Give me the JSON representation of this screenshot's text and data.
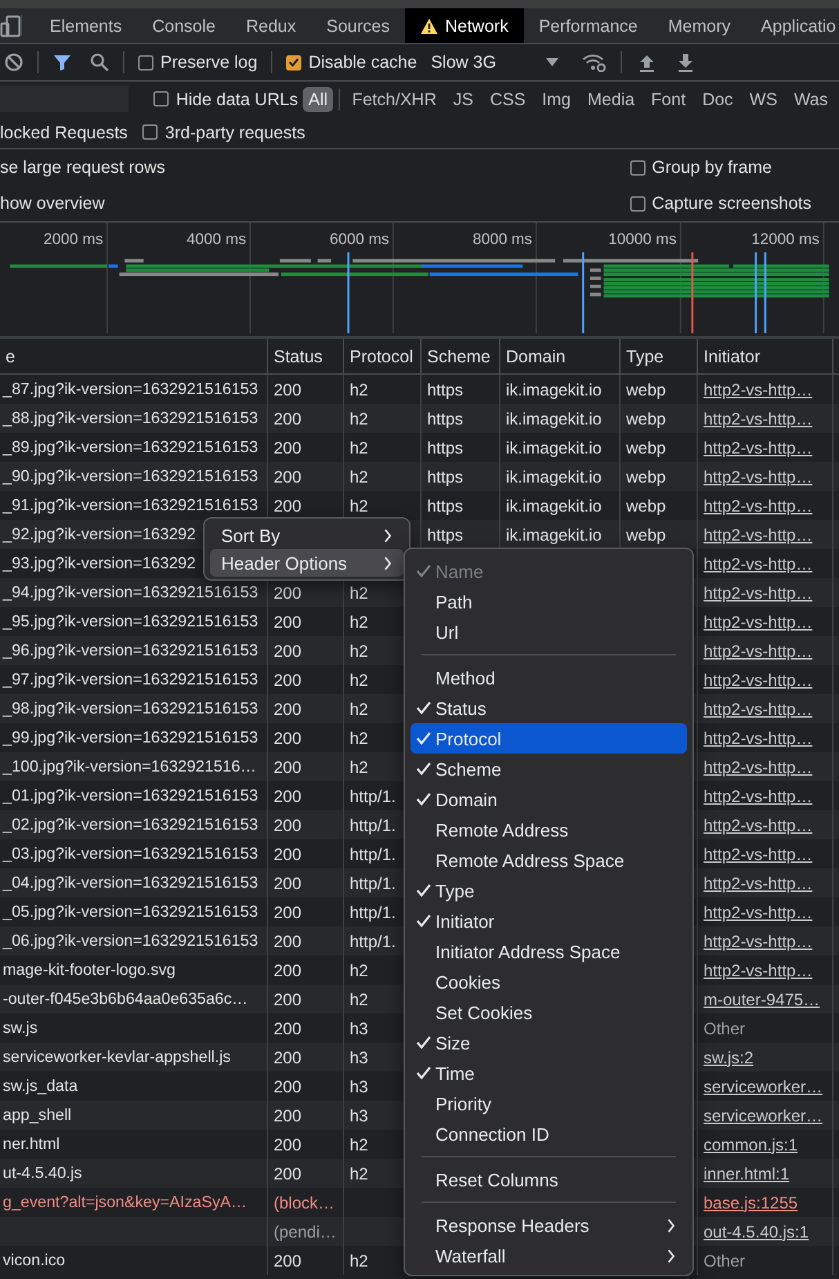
{
  "tabs": [
    {
      "label": "Elements",
      "selected": false,
      "warning": false
    },
    {
      "label": "Console",
      "selected": false,
      "warning": false
    },
    {
      "label": "Redux",
      "selected": false,
      "warning": false
    },
    {
      "label": "Sources",
      "selected": false,
      "warning": false
    },
    {
      "label": "Network",
      "selected": true,
      "warning": true
    },
    {
      "label": "Performance",
      "selected": false,
      "warning": false
    },
    {
      "label": "Memory",
      "selected": false,
      "warning": false
    },
    {
      "label": "Applicatio",
      "selected": false,
      "warning": false
    }
  ],
  "toolbar": {
    "preserve_log": {
      "label": "Preserve log",
      "checked": false
    },
    "disable_cache": {
      "label": "Disable cache",
      "checked": true
    },
    "throttling": "Slow 3G"
  },
  "filter_bar": {
    "hide_data_urls": {
      "label": "Hide data URLs",
      "checked": false
    },
    "types": [
      {
        "label": "All",
        "selected": true
      },
      {
        "label": "Fetch/XHR",
        "selected": false
      },
      {
        "label": "JS",
        "selected": false
      },
      {
        "label": "CSS",
        "selected": false
      },
      {
        "label": "Img",
        "selected": false
      },
      {
        "label": "Media",
        "selected": false
      },
      {
        "label": "Font",
        "selected": false
      },
      {
        "label": "Doc",
        "selected": false
      },
      {
        "label": "WS",
        "selected": false
      },
      {
        "label": "Was",
        "selected": false
      }
    ]
  },
  "filter_row_2": {
    "blocked_label": "locked Requests",
    "third_party": {
      "label": "3rd-party requests",
      "checked": false
    }
  },
  "settings": {
    "left": [
      "se large request rows",
      "how overview"
    ],
    "right": [
      {
        "label": "Group by frame",
        "checked": false
      },
      {
        "label": "Capture screenshots",
        "checked": false
      }
    ]
  },
  "overview": {
    "ticks": [
      "2000 ms",
      "4000 ms",
      "6000 ms",
      "8000 ms",
      "10000 ms",
      "12000 ms"
    ]
  },
  "table": {
    "columns": [
      "e",
      "Status",
      "Protocol",
      "Scheme",
      "Domain",
      "Type",
      "Initiator"
    ],
    "rows": [
      {
        "kind": "normal",
        "name": "_87.jpg?ik-version=1632921516153",
        "status": "200",
        "protocol": "h2",
        "scheme": "https",
        "domain": "ik.imagekit.io",
        "type": "webp",
        "initiator": {
          "text": "http2-vs-http…",
          "link": true
        }
      },
      {
        "kind": "normal",
        "name": "_88.jpg?ik-version=1632921516153",
        "status": "200",
        "protocol": "h2",
        "scheme": "https",
        "domain": "ik.imagekit.io",
        "type": "webp",
        "initiator": {
          "text": "http2-vs-http…",
          "link": true
        }
      },
      {
        "kind": "normal",
        "name": "_89.jpg?ik-version=1632921516153",
        "status": "200",
        "protocol": "h2",
        "scheme": "https",
        "domain": "ik.imagekit.io",
        "type": "webp",
        "initiator": {
          "text": "http2-vs-http…",
          "link": true
        }
      },
      {
        "kind": "normal",
        "name": "_90.jpg?ik-version=1632921516153",
        "status": "200",
        "protocol": "h2",
        "scheme": "https",
        "domain": "ik.imagekit.io",
        "type": "webp",
        "initiator": {
          "text": "http2-vs-http…",
          "link": true
        }
      },
      {
        "kind": "normal",
        "name": "_91.jpg?ik-version=1632921516153",
        "status": "200",
        "protocol": "h2",
        "scheme": "https",
        "domain": "ik.imagekit.io",
        "type": "webp",
        "initiator": {
          "text": "http2-vs-http…",
          "link": true
        }
      },
      {
        "kind": "normal",
        "name": "_92.jpg?ik-version=163292",
        "scheme": "https",
        "domain": "ik.imagekit.io",
        "type": "webp",
        "initiator": {
          "text": "http2-vs-http…",
          "link": true
        }
      },
      {
        "kind": "normal",
        "name": "_93.jpg?ik-version=163292",
        "initiator": {
          "text": "http2-vs-http…",
          "link": true
        }
      },
      {
        "kind": "normal",
        "name": "_94.jpg?ik-version=1632921516153",
        "status": "200",
        "protocol": "h2",
        "initiator": {
          "text": "http2-vs-http…",
          "link": true
        }
      },
      {
        "kind": "normal",
        "name": "_95.jpg?ik-version=1632921516153",
        "status": "200",
        "protocol": "h2",
        "initiator": {
          "text": "http2-vs-http…",
          "link": true
        }
      },
      {
        "kind": "normal",
        "name": "_96.jpg?ik-version=1632921516153",
        "status": "200",
        "protocol": "h2",
        "initiator": {
          "text": "http2-vs-http…",
          "link": true
        }
      },
      {
        "kind": "normal",
        "name": "_97.jpg?ik-version=1632921516153",
        "status": "200",
        "protocol": "h2",
        "initiator": {
          "text": "http2-vs-http…",
          "link": true
        }
      },
      {
        "kind": "normal",
        "name": "_98.jpg?ik-version=1632921516153",
        "status": "200",
        "protocol": "h2",
        "initiator": {
          "text": "http2-vs-http…",
          "link": true
        }
      },
      {
        "kind": "normal",
        "name": "_99.jpg?ik-version=1632921516153",
        "status": "200",
        "protocol": "h2",
        "initiator": {
          "text": "http2-vs-http…",
          "link": true
        }
      },
      {
        "kind": "normal",
        "name": "_100.jpg?ik-version=1632921516…",
        "status": "200",
        "protocol": "h2",
        "initiator": {
          "text": "http2-vs-http…",
          "link": true
        }
      },
      {
        "kind": "normal",
        "name": "_01.jpg?ik-version=1632921516153",
        "status": "200",
        "protocol": "http/1.",
        "initiator": {
          "text": "http2-vs-http…",
          "link": true
        }
      },
      {
        "kind": "normal",
        "name": "_02.jpg?ik-version=1632921516153",
        "status": "200",
        "protocol": "http/1.",
        "initiator": {
          "text": "http2-vs-http…",
          "link": true
        }
      },
      {
        "kind": "normal",
        "name": "_03.jpg?ik-version=1632921516153",
        "status": "200",
        "protocol": "http/1.",
        "initiator": {
          "text": "http2-vs-http…",
          "link": true
        }
      },
      {
        "kind": "normal",
        "name": "_04.jpg?ik-version=1632921516153",
        "status": "200",
        "protocol": "http/1.",
        "initiator": {
          "text": "http2-vs-http…",
          "link": true
        }
      },
      {
        "kind": "normal",
        "name": "_05.jpg?ik-version=1632921516153",
        "status": "200",
        "protocol": "http/1.",
        "initiator": {
          "text": "http2-vs-http…",
          "link": true
        }
      },
      {
        "kind": "normal",
        "name": "_06.jpg?ik-version=1632921516153",
        "status": "200",
        "protocol": "http/1.",
        "initiator": {
          "text": "http2-vs-http…",
          "link": true
        }
      },
      {
        "kind": "normal",
        "name": "mage-kit-footer-logo.svg",
        "status": "200",
        "protocol": "h2",
        "initiator": {
          "text": "http2-vs-http…",
          "link": true
        }
      },
      {
        "kind": "normal",
        "name": "-outer-f045e3b6b64aa0e635a6c…",
        "status": "200",
        "protocol": "h2",
        "initiator": {
          "text": "m-outer-9475…",
          "link": true
        }
      },
      {
        "kind": "normal",
        "name": "sw.js",
        "status": "200",
        "protocol": "h3",
        "initiator": {
          "text": "Other",
          "link": false
        }
      },
      {
        "kind": "normal",
        "name": "serviceworker-kevlar-appshell.js",
        "status": "200",
        "protocol": "h3",
        "initiator": {
          "text": "sw.js:2",
          "link": true
        }
      },
      {
        "kind": "normal",
        "name": "sw.js_data",
        "status": "200",
        "protocol": "h3",
        "initiator": {
          "text": "serviceworker…",
          "link": true
        }
      },
      {
        "kind": "normal",
        "name": "app_shell",
        "status": "200",
        "protocol": "h3",
        "initiator": {
          "text": "serviceworker…",
          "link": true
        }
      },
      {
        "kind": "normal",
        "name": "ner.html",
        "status": "200",
        "protocol": "h2",
        "initiator": {
          "text": "common.js:1",
          "link": true
        }
      },
      {
        "kind": "normal",
        "name": "ut-4.5.40.js",
        "status": "200",
        "protocol": "h2",
        "initiator": {
          "text": "inner.html:1",
          "link": true
        }
      },
      {
        "kind": "blocked",
        "name": "g_event?alt=json&key=AIzaSyA…",
        "status": "(block…",
        "initiator": {
          "text": "base.js:1255",
          "link": true
        }
      },
      {
        "kind": "pending",
        "status": "(pendi…",
        "initiator": {
          "text": "out-4.5.40.js:1",
          "link": true
        }
      },
      {
        "kind": "normal",
        "name": "vicon.ico",
        "status": "200",
        "protocol": "h2",
        "initiator": {
          "text": "Other",
          "link": false
        }
      }
    ]
  },
  "context_menu": {
    "items": [
      {
        "label": "Sort By",
        "selected": false
      },
      {
        "label": "Header Options",
        "selected": true
      }
    ]
  },
  "header_options_menu": {
    "items": [
      {
        "kind": "item",
        "label": "Name",
        "checked": true,
        "selected": false,
        "disabled": true
      },
      {
        "kind": "item",
        "label": "Path",
        "checked": false,
        "selected": false,
        "disabled": false
      },
      {
        "kind": "item",
        "label": "Url",
        "checked": false,
        "selected": false,
        "disabled": false
      },
      {
        "kind": "separator"
      },
      {
        "kind": "item",
        "label": "Method",
        "checked": false,
        "selected": false,
        "disabled": false
      },
      {
        "kind": "item",
        "label": "Status",
        "checked": true,
        "selected": false,
        "disabled": false
      },
      {
        "kind": "item",
        "label": "Protocol",
        "checked": true,
        "selected": true,
        "disabled": false
      },
      {
        "kind": "item",
        "label": "Scheme",
        "checked": true,
        "selected": false,
        "disabled": false
      },
      {
        "kind": "item",
        "label": "Domain",
        "checked": true,
        "selected": false,
        "disabled": false
      },
      {
        "kind": "item",
        "label": "Remote Address",
        "checked": false,
        "selected": false,
        "disabled": false
      },
      {
        "kind": "item",
        "label": "Remote Address Space",
        "checked": false,
        "selected": false,
        "disabled": false
      },
      {
        "kind": "item",
        "label": "Type",
        "checked": true,
        "selected": false,
        "disabled": false
      },
      {
        "kind": "item",
        "label": "Initiator",
        "checked": true,
        "selected": false,
        "disabled": false
      },
      {
        "kind": "item",
        "label": "Initiator Address Space",
        "checked": false,
        "selected": false,
        "disabled": false
      },
      {
        "kind": "item",
        "label": "Cookies",
        "checked": false,
        "selected": false,
        "disabled": false
      },
      {
        "kind": "item",
        "label": "Set Cookies",
        "checked": false,
        "selected": false,
        "disabled": false
      },
      {
        "kind": "item",
        "label": "Size",
        "checked": true,
        "selected": false,
        "disabled": false
      },
      {
        "kind": "item",
        "label": "Time",
        "checked": true,
        "selected": false,
        "disabled": false
      },
      {
        "kind": "item",
        "label": "Priority",
        "checked": false,
        "selected": false,
        "disabled": false
      },
      {
        "kind": "item",
        "label": "Connection ID",
        "checked": false,
        "selected": false,
        "disabled": false
      },
      {
        "kind": "separator"
      },
      {
        "kind": "item",
        "label": "Reset Columns",
        "checked": false,
        "selected": false,
        "disabled": false
      },
      {
        "kind": "separator"
      },
      {
        "kind": "submenu",
        "label": "Response Headers",
        "checked": false,
        "selected": false,
        "disabled": false
      },
      {
        "kind": "submenu",
        "label": "Waterfall",
        "checked": false,
        "selected": false,
        "disabled": false
      }
    ]
  }
}
